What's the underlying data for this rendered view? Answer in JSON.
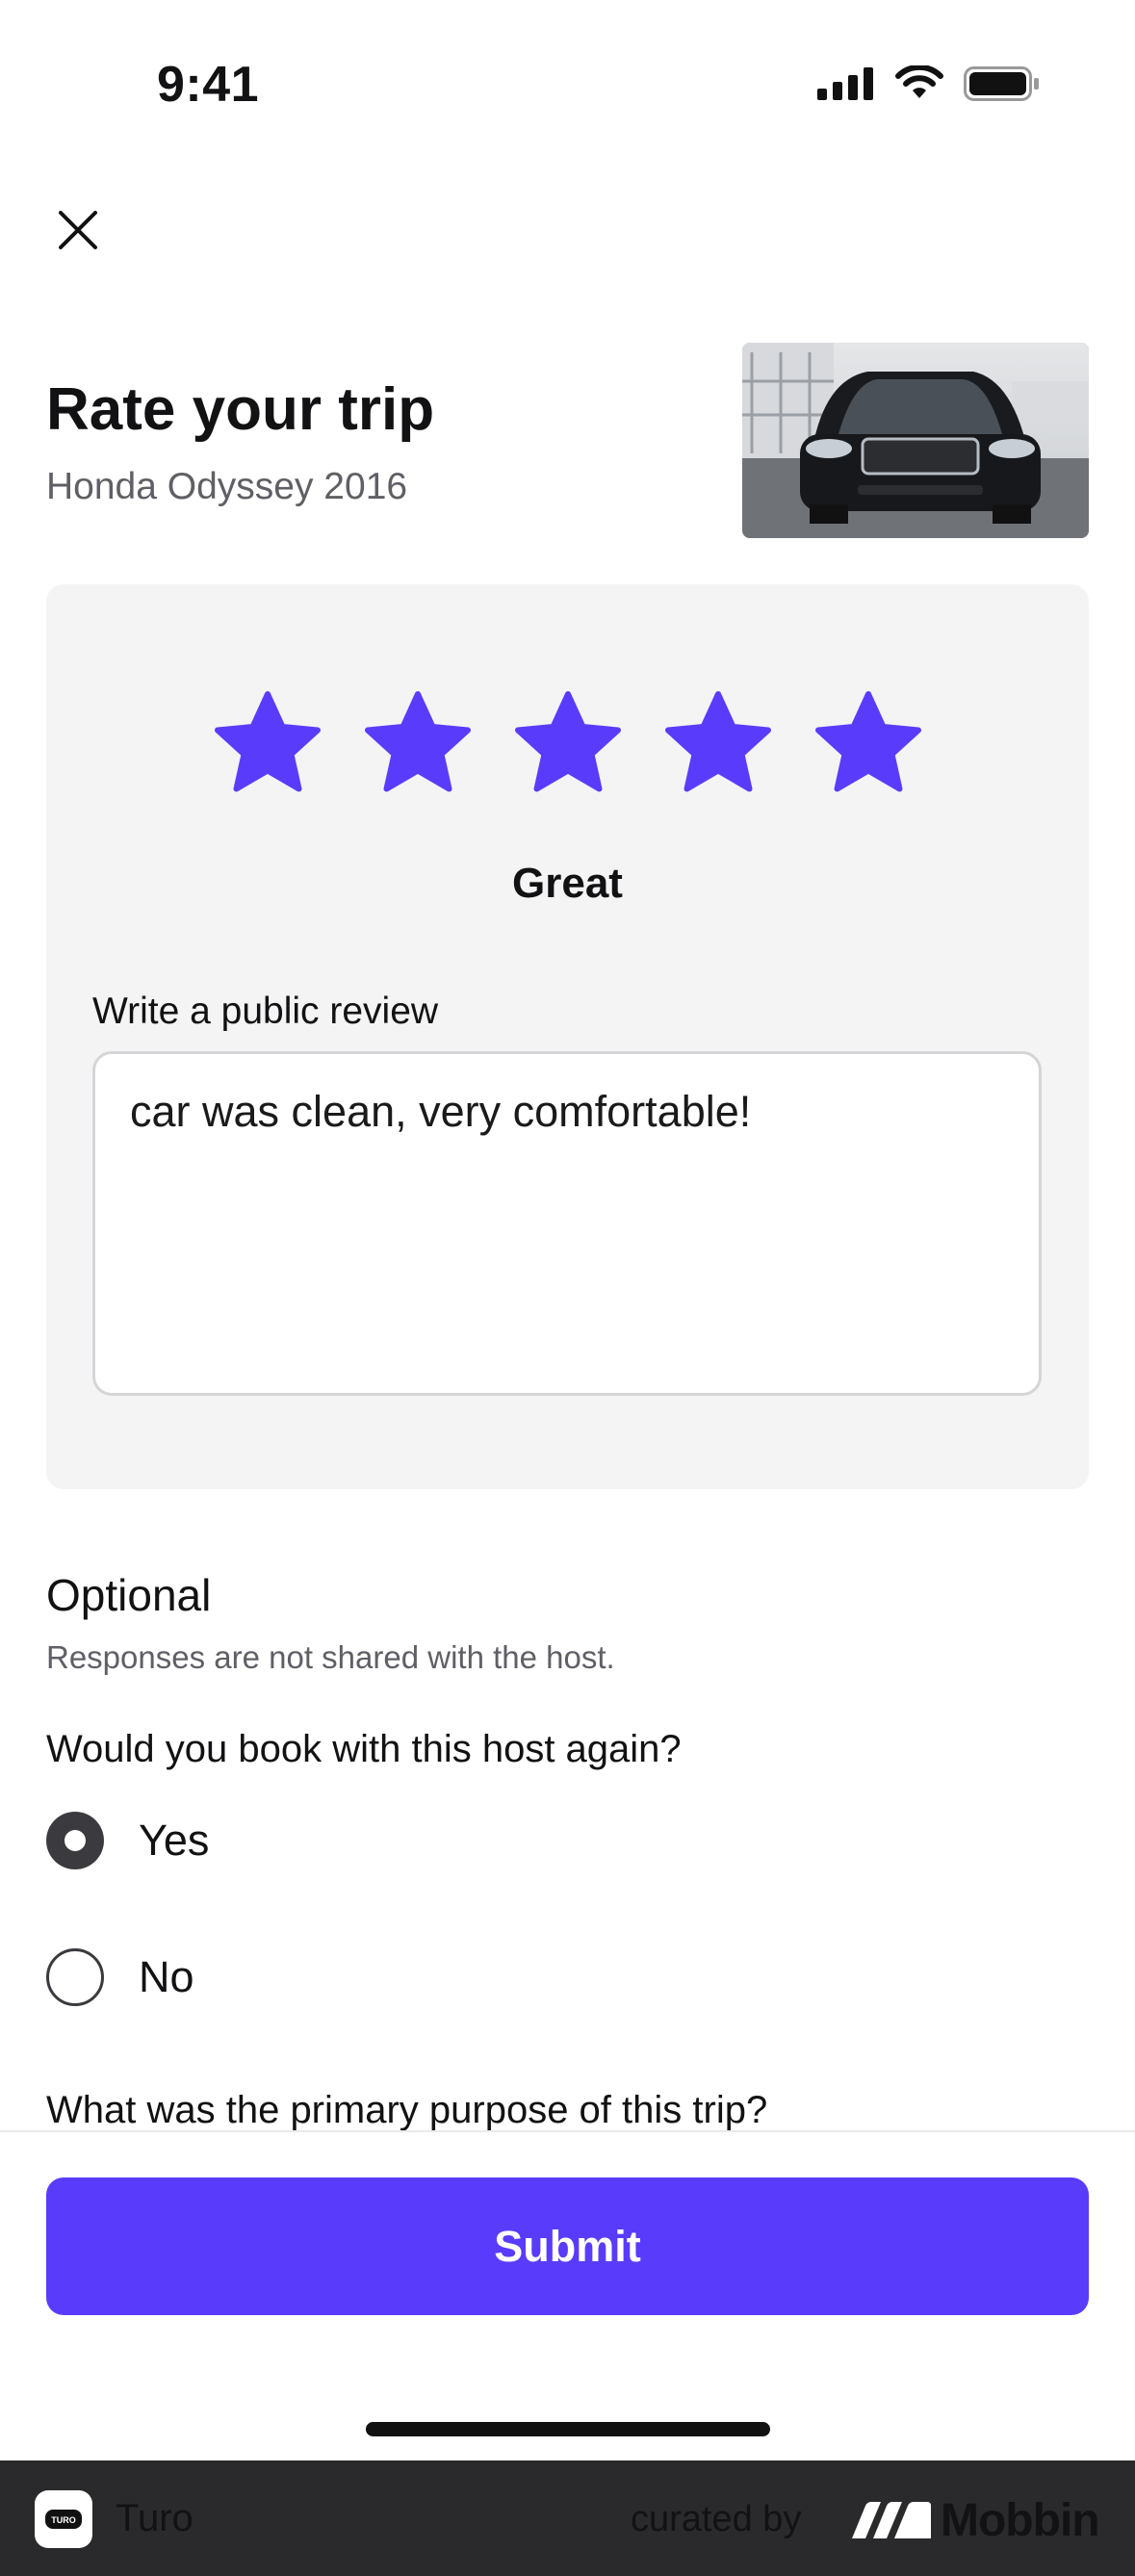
{
  "status_bar": {
    "time": "9:41",
    "icons": [
      "signal-icon",
      "wifi-icon",
      "battery-icon"
    ]
  },
  "header": {
    "close_icon": "close-icon",
    "title": "Rate your trip",
    "subtitle": "Honda Odyssey 2016"
  },
  "rating": {
    "stars_selected": 5,
    "stars_total": 5,
    "label": "Great",
    "star_color": "#593cfb"
  },
  "review": {
    "label": "Write a public review",
    "value": "car was clean, very comfortable!"
  },
  "optional": {
    "heading": "Optional",
    "subtext": "Responses are not shared with the host.",
    "question": "Would you book with this host again?",
    "options": [
      {
        "label": "Yes",
        "selected": true
      },
      {
        "label": "No",
        "selected": false
      }
    ],
    "next_question": "What was the primary purpose of this trip?"
  },
  "footer": {
    "submit_label": "Submit",
    "accent_color": "#593cfb"
  },
  "branding": {
    "app_name": "Turo",
    "app_icon_text": "TURO",
    "curated_by": "curated by",
    "mobbin": "Mobbin"
  }
}
